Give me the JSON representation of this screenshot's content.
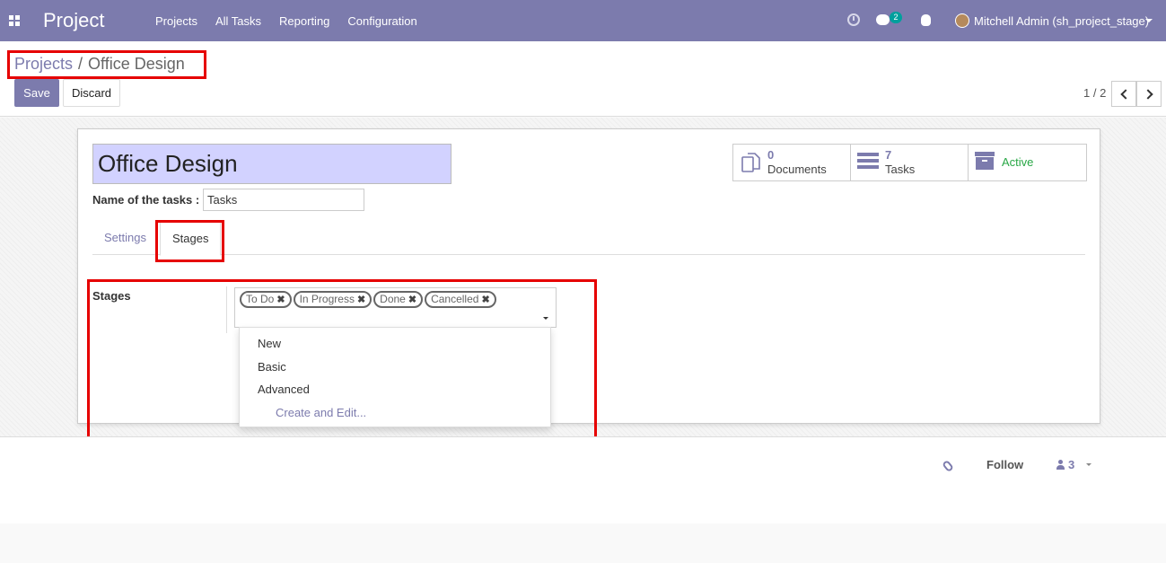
{
  "navbar": {
    "brand": "Project",
    "menu": [
      "Projects",
      "All Tasks",
      "Reporting",
      "Configuration"
    ],
    "chat_badge": "2",
    "user": "Mitchell Admin (sh_project_stage)",
    "icons": [
      "apps-icon",
      "clock-icon",
      "chat-icon",
      "bug-icon",
      "avatar",
      "caret-down-icon"
    ]
  },
  "breadcrumb": {
    "parent": "Projects",
    "separator": "/",
    "current": "Office Design"
  },
  "buttons": {
    "save": "Save",
    "discard": "Discard"
  },
  "pager": {
    "value": "1 / 2"
  },
  "form": {
    "title": "Office Design",
    "tasks_label": "Name of the tasks :",
    "tasks_value": "Tasks"
  },
  "smart_buttons": {
    "documents": {
      "count": "0",
      "label": "Documents"
    },
    "tasks": {
      "count": "7",
      "label": "Tasks"
    },
    "active": {
      "label": "Active"
    }
  },
  "tabs": {
    "settings": "Settings",
    "stages": "Stages"
  },
  "stages": {
    "label": "Stages",
    "tags": [
      "To Do",
      "In Progress",
      "Done",
      "Cancelled"
    ],
    "dropdown": [
      "New",
      "Basic",
      "Advanced"
    ],
    "create_edit": "Create and Edit..."
  },
  "chatter": {
    "follow": "Follow",
    "followers": "3"
  },
  "colors": {
    "brand": "#7c7bad",
    "highlight": "#e60000",
    "active": "#28a745"
  }
}
